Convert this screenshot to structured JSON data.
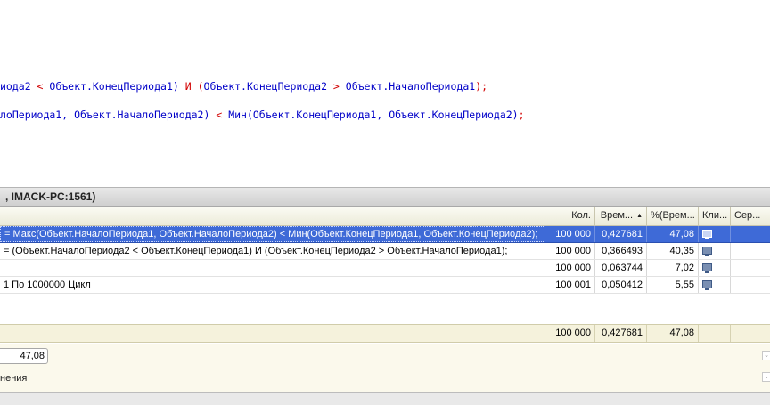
{
  "code": {
    "line1": {
      "part1": "иода2",
      "op1": " < ",
      "part2": "Объект.КонецПериода1) ",
      "op2": "И (",
      "part3": "Объект.КонецПериода2",
      "op3": " > ",
      "part4": "Объект.НачалоПериода1",
      "op4": ");"
    },
    "line2": {
      "part1": "лоПериода1, Объект.НачалоПериода2)",
      "op1": " < ",
      "part2": "Мин(Объект.КонецПериода1, Объект.КонецПериода2)",
      "op2": ";"
    }
  },
  "panel": {
    "title": ", IMACK-PC:1561)"
  },
  "table": {
    "headers": {
      "count": "Кол.",
      "time": "Врем...",
      "percent": "%(Врем...",
      "client": "Кли...",
      "server": "Сер..."
    },
    "rows": [
      {
        "text": " = Макс(Объект.НачалоПериода1, Объект.НачалоПериода2) < Мин(Объект.КонецПериода1, Объект.КонецПериода2);",
        "count": "100 000",
        "time": "0,427681",
        "percent": "47,08",
        "client_icon": "monitor-icon",
        "selected": true
      },
      {
        "text": " = (Объект.НачалоПериода2 < Объект.КонецПериода1) И (Объект.КонецПериода2 > Объект.НачалоПериода1);",
        "count": "100 000",
        "time": "0,366493",
        "percent": "40,35",
        "client_icon": "monitor-icon",
        "selected": false
      },
      {
        "text": "",
        "count": "100 000",
        "time": "0,063744",
        "percent": "7,02",
        "client_icon": "monitor-icon",
        "selected": false
      },
      {
        "text": " 1 По 1000000 Цикл",
        "count": "100 001",
        "time": "0,050412",
        "percent": "5,55",
        "client_icon": "monitor-icon",
        "selected": false
      }
    ],
    "totals": {
      "count": "100 000",
      "time": "0,427681",
      "percent": "47,08"
    }
  },
  "footer": {
    "value": "47,08",
    "label": "нения"
  },
  "colors": {
    "selection": "#3e6ad7",
    "code_red": "#d20000",
    "code_blue": "#0000c8"
  }
}
